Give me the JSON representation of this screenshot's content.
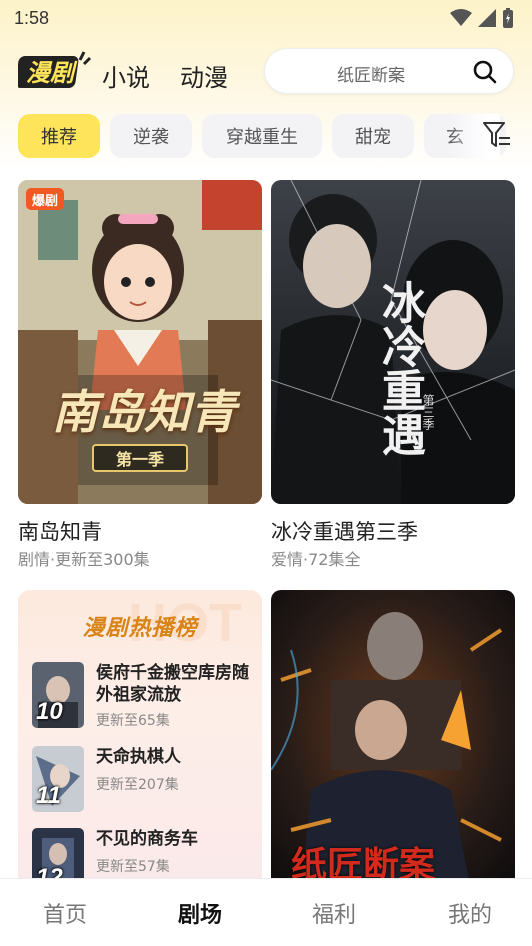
{
  "status": {
    "time": "1:58"
  },
  "header": {
    "logo_text": "漫剧",
    "tabs": [
      {
        "label": "小说"
      },
      {
        "label": "动漫"
      }
    ],
    "search_placeholder": "纸匠断案"
  },
  "chips": [
    {
      "label": "推荐",
      "active": true
    },
    {
      "label": "逆袭"
    },
    {
      "label": "穿越重生"
    },
    {
      "label": "甜宠"
    },
    {
      "label": "玄"
    }
  ],
  "cards": [
    {
      "title": "南岛知青",
      "sub": "剧情·更新至300集",
      "badge": "爆剧",
      "cover_title": "南岛知青",
      "cover_season": "第一季"
    },
    {
      "title": "冰冷重遇第三季",
      "sub": "爱情·72集全",
      "cover_title": "冰冷重遇",
      "cover_season": "第三季"
    },
    {
      "cover_title": "纸匠断案"
    }
  ],
  "rank": {
    "title": "漫剧热播榜",
    "items": [
      {
        "num": "10",
        "name": "侯府千金搬空库房随外祖家流放",
        "ep": "更新至65集"
      },
      {
        "num": "11",
        "name": "天命执棋人",
        "ep": "更新至207集"
      },
      {
        "num": "12",
        "name": "不见的商务车",
        "ep": "更新至57集"
      }
    ]
  },
  "bottom_nav": [
    {
      "label": "首页"
    },
    {
      "label": "剧场",
      "active": true
    },
    {
      "label": "福利"
    },
    {
      "label": "我的"
    }
  ],
  "colors": {
    "accent": "#fde45a",
    "badge": "#f05a22",
    "rank_title": "#d98418"
  }
}
